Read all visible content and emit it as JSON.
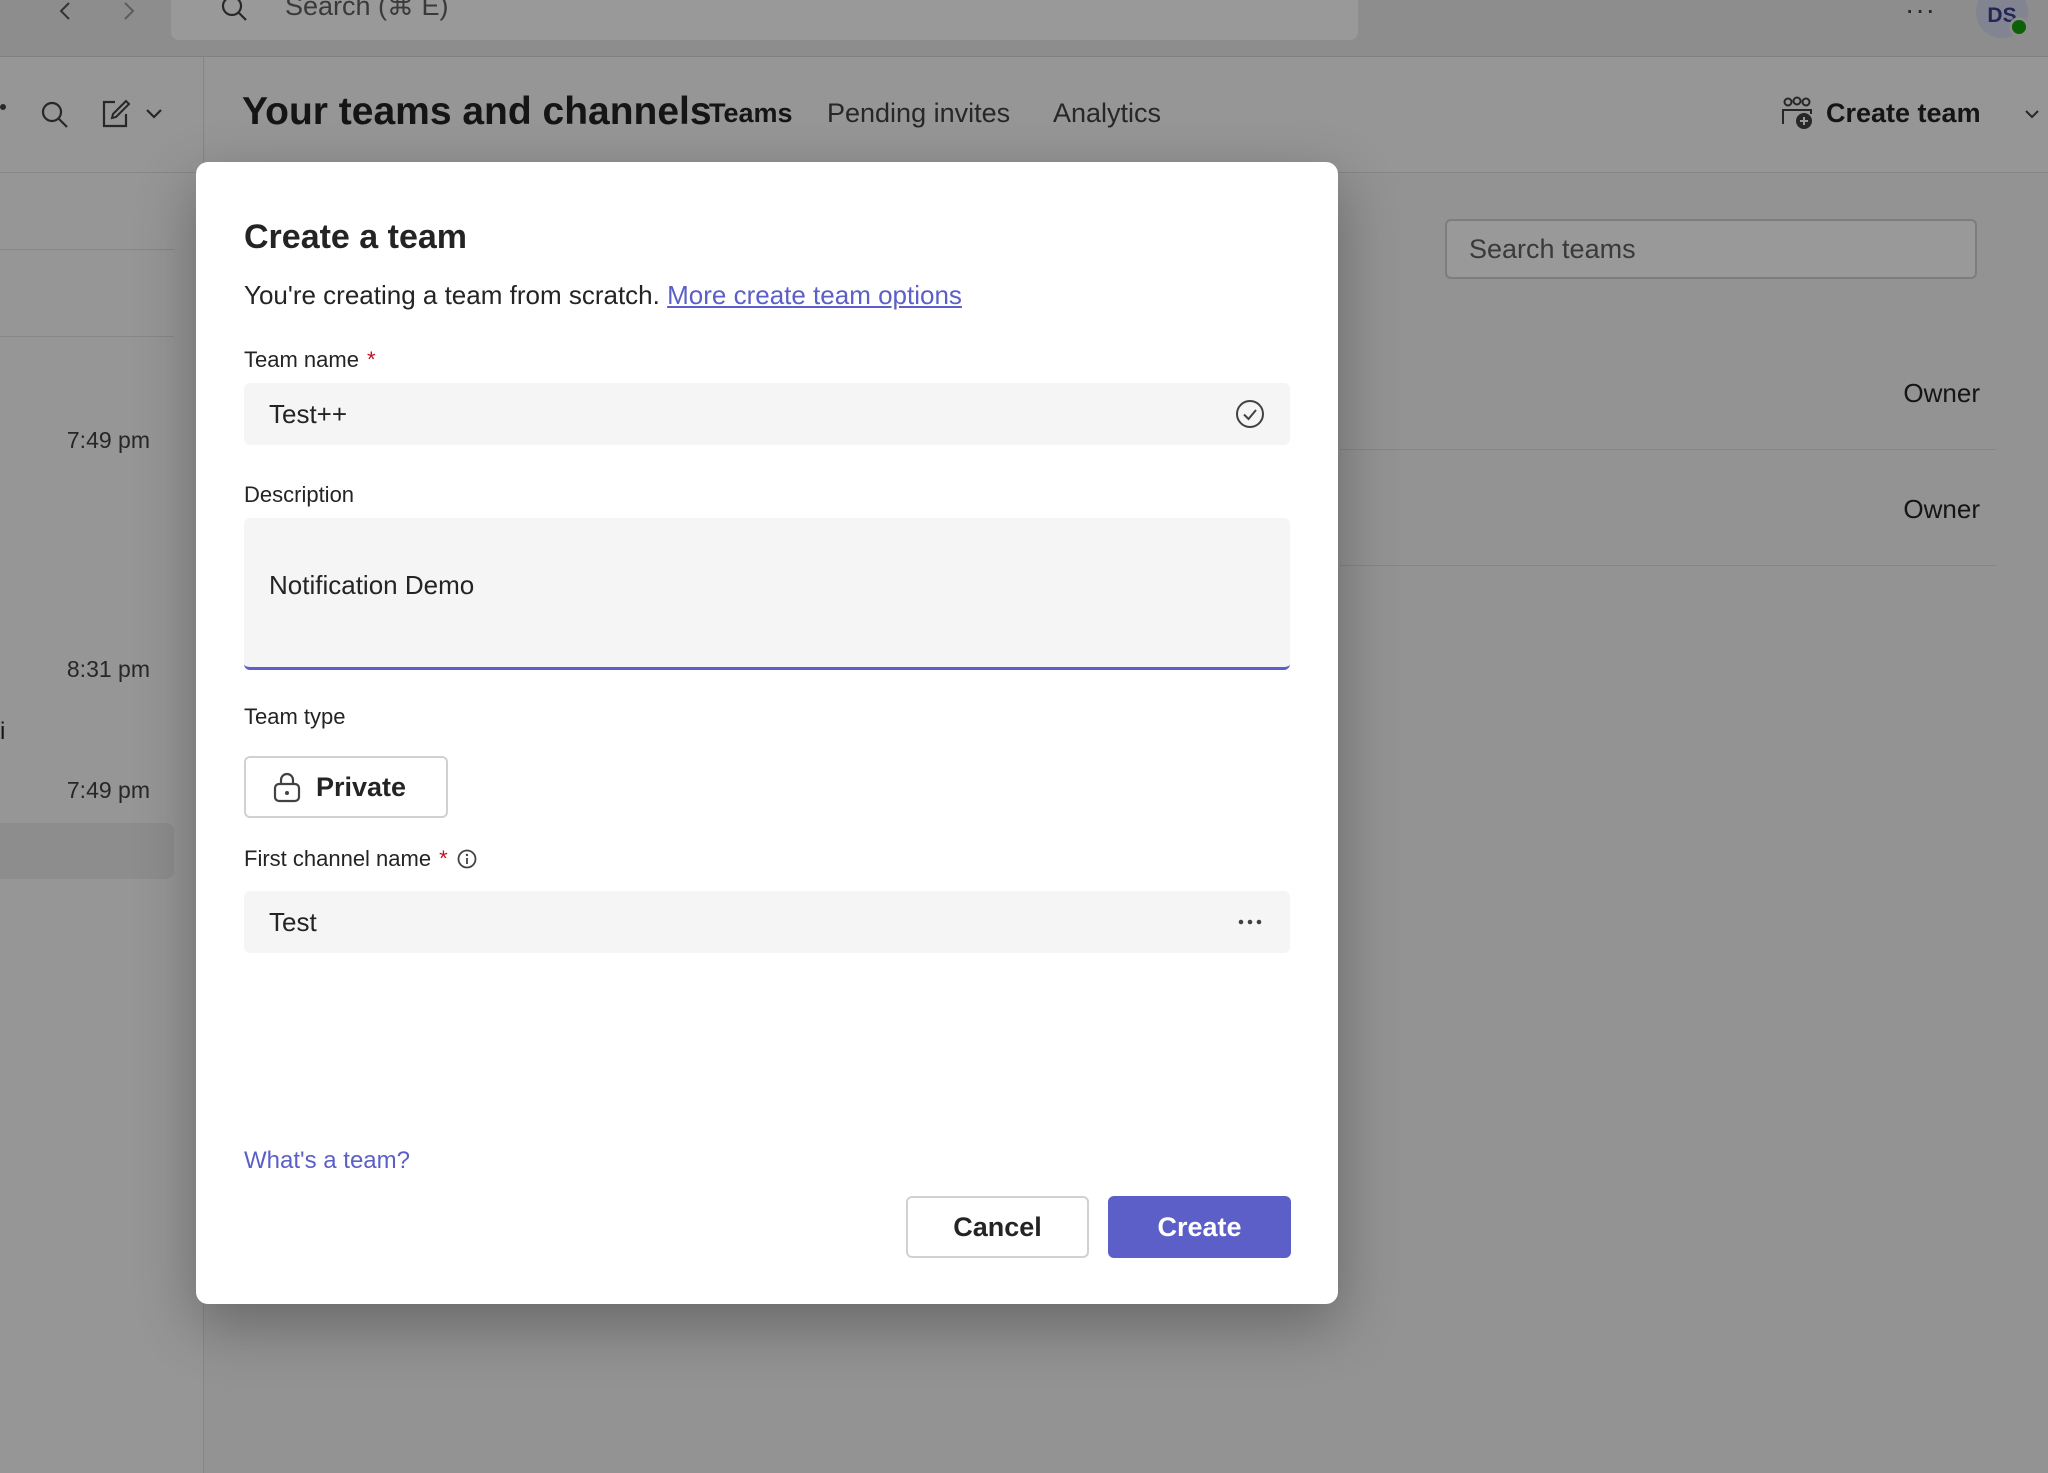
{
  "titlebar": {
    "search_placeholder": "Search (⌘ E)",
    "more_label": "···",
    "avatar_initials": "DS",
    "presence_color": "#13a10e"
  },
  "left_pane": {
    "times": [
      "7:49 pm",
      "8:31 pm",
      "7:49 pm"
    ],
    "fragment": "i"
  },
  "main": {
    "title": "Your teams and channels",
    "tabs": [
      {
        "label": "Teams",
        "active": true
      },
      {
        "label": "Pending invites",
        "active": false
      },
      {
        "label": "Analytics",
        "active": false
      }
    ],
    "create_team_label": "Create team",
    "search_placeholder": "Search teams",
    "rows": [
      {
        "role": "Owner"
      },
      {
        "role": "Owner"
      }
    ]
  },
  "dialog": {
    "title": "Create a team",
    "subtitle": "You're creating a team from scratch.",
    "more_options_link": "More create team options",
    "team_name_label": "Team name",
    "team_name_value": "Test++",
    "required_mark": "*",
    "description_label": "Description",
    "description_value": "Notification Demo",
    "team_type_label": "Team type",
    "team_type_value": "Private",
    "first_channel_label": "First channel name",
    "first_channel_value": "Test",
    "help_link": "What's a team?",
    "cancel_label": "Cancel",
    "create_label": "Create",
    "accent_color": "#5b5fc7"
  }
}
